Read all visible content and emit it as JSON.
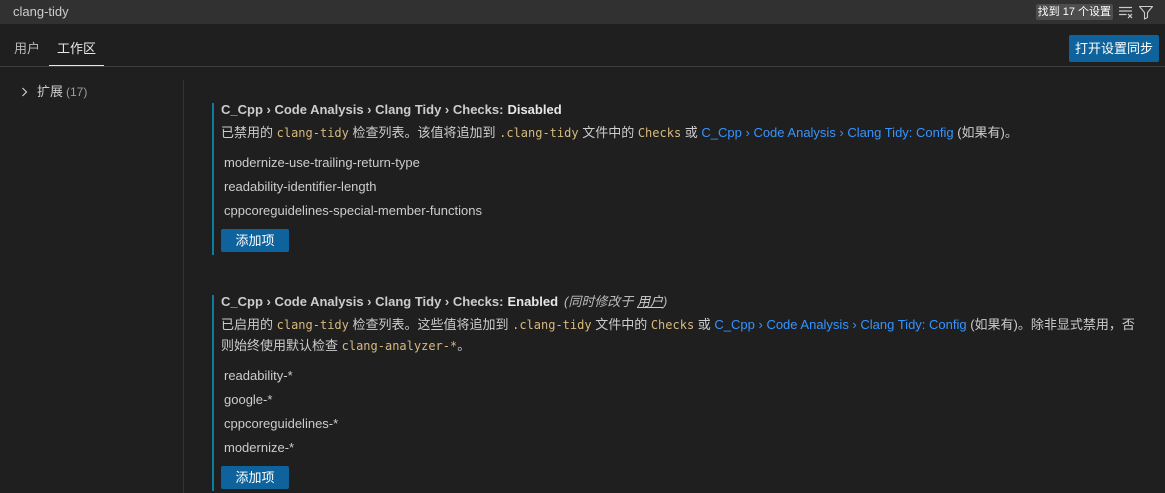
{
  "search": {
    "value": "clang-tidy",
    "results": "找到 17 个设置"
  },
  "icons": {
    "clear_search": "clear-all-icon",
    "filter": "filter-icon",
    "toc_expand": "chevron-right-icon"
  },
  "tabs": [
    {
      "label": "用户",
      "active": false
    },
    {
      "label": "工作区",
      "active": true
    }
  ],
  "sync_button": "打开设置同步",
  "toc": {
    "items": [
      {
        "label": "扩展",
        "count": "(17)"
      }
    ]
  },
  "settings": [
    {
      "category": "C_Cpp › Code Analysis › Clang Tidy › Checks:",
      "label": "Disabled",
      "description": [
        "已禁用的 ",
        "clang-tidy",
        " 检查列表。该值将追加到 ",
        ".clang-tidy",
        " 文件中的 ",
        "Checks",
        " 或 ",
        "C_Cpp › Code Analysis › Clang Tidy: Config",
        " (如果有)。"
      ],
      "items": [
        "modernize-use-trailing-return-type",
        "readability-identifier-length",
        "cppcoreguidelines-special-member-functions"
      ],
      "add_button": "添加项"
    },
    {
      "category": "C_Cpp › Code Analysis › Clang Tidy › Checks:",
      "label": "Enabled",
      "modified_elsewhere": {
        "prefix": "(同时修改于 ",
        "scope": "用户",
        "suffix": ")"
      },
      "description": [
        "已启用的 ",
        "clang-tidy",
        " 检查列表。这些值将追加到 ",
        ".clang-tidy",
        " 文件中的 ",
        "Checks",
        " 或 ",
        "C_Cpp › Code Analysis › Clang Tidy: Config",
        " (如果有)。除非显式禁用，否则始终使用默认检查 ",
        "clang-analyzer-*",
        "。"
      ],
      "items": [
        "readability-*",
        "google-*",
        "cppcoreguidelines-*",
        "modernize-*"
      ],
      "add_button": "添加项"
    }
  ],
  "colors": {
    "background": "#1f1f1f",
    "input_background": "#313131",
    "foreground": "#cccccc",
    "badge_background": "#4d4d4d",
    "button_background": "#0e639c",
    "modified_indicator": "#0c7d9d",
    "link": "#3794ff",
    "code": "#d7ba7d"
  }
}
